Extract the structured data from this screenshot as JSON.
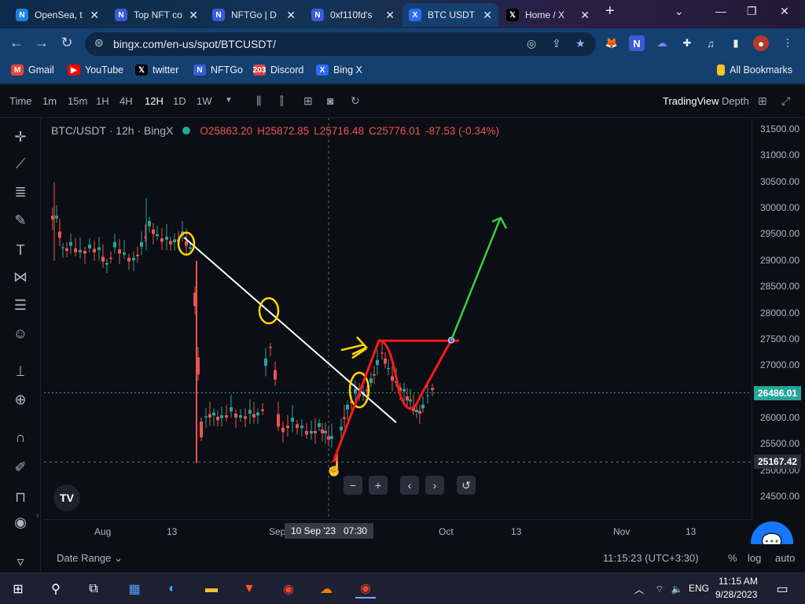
{
  "browser": {
    "tabs": [
      {
        "title": "OpenSea, t",
        "fav": "opensea-icon",
        "color": "#2081e2"
      },
      {
        "title": "Top NFT co",
        "fav": "nftgo-icon",
        "color": "#3b5bdb"
      },
      {
        "title": "NFTGo | D",
        "fav": "nftgo-icon",
        "color": "#3b5bdb"
      },
      {
        "title": "0xf110fd's",
        "fav": "nftgo-icon",
        "color": "#3b5bdb"
      },
      {
        "title": "BTC USDT",
        "fav": "bingx-icon",
        "color": "#2d6cf5"
      },
      {
        "title": "Home / X",
        "fav": "x-icon",
        "color": "#000000"
      }
    ],
    "url": "bingx.com/en-us/spot/BTCUSDT/",
    "bookmarks": [
      {
        "label": "Gmail",
        "icon": "gmail-icon",
        "glyph": "M",
        "color": "#ea4335"
      },
      {
        "label": "YouTube",
        "icon": "youtube-icon",
        "glyph": "▶",
        "color": "#ff0000"
      },
      {
        "label": "twitter",
        "icon": "x-icon",
        "glyph": "𝕏",
        "color": "#000000"
      },
      {
        "label": "NFTGo",
        "icon": "nftgo-icon",
        "glyph": "N",
        "color": "#3b5bdb"
      },
      {
        "label": "Discord",
        "icon": "discord-icon",
        "glyph": "203",
        "color": "#d64545"
      },
      {
        "label": "Bing X",
        "icon": "bingx-icon",
        "glyph": "X",
        "color": "#2d6cf5"
      }
    ],
    "all_bookmarks": "All Bookmarks"
  },
  "toolbar": {
    "intervals": [
      "Time",
      "1m",
      "15m",
      "1H",
      "4H",
      "12H",
      "1D",
      "1W"
    ],
    "selected": "12H",
    "right_labels": [
      "TradingView",
      "Depth"
    ]
  },
  "legend": {
    "symbol": "BTC/USDT · 12h · BingX",
    "o_label": "O",
    "o": "25863.20",
    "h_label": "H",
    "h": "25872.85",
    "l_label": "L",
    "l": "25716.48",
    "c_label": "C",
    "c": "25776.01",
    "change": "-87.53 (-0.34%)",
    "down_color": "#ef5350"
  },
  "price_axis": {
    "labels": [
      "31500.00",
      "31000.00",
      "30500.00",
      "30000.00",
      "29500.00",
      "29000.00",
      "28500.00",
      "28000.00",
      "27500.00",
      "27000.00",
      "26500.00",
      "26000.00",
      "25500.00",
      "25000.00",
      "24500.00"
    ],
    "current_price": "26486.01",
    "current_color": "#26a69a",
    "low_price": "25167.42"
  },
  "time_axis": {
    "labels": [
      "Aug",
      "13",
      "Sep",
      "Oct",
      "13",
      "Nov",
      "13"
    ],
    "crosshair_label": "10 Sep '23   07:30"
  },
  "bottom": {
    "date_range": "Date Range",
    "clock": "11:15:23 (UTC+3:30)",
    "percent": "%",
    "log": "log",
    "auto": "auto"
  },
  "taskbar": {
    "lang": "ENG",
    "time": "11:15 AM",
    "date": "9/28/2023"
  },
  "chart_data": {
    "type": "candlestick",
    "title": "BTC/USDT · 12h · BingX",
    "ylim": [
      24300,
      31700
    ],
    "up_color": "#26a69a",
    "down_color": "#ef5350",
    "annotations": {
      "trendline_color": "#ffffff",
      "circle_color": "#ffd600",
      "path_color": "#ff1a1a",
      "projection_color": "#3ad13a"
    }
  }
}
